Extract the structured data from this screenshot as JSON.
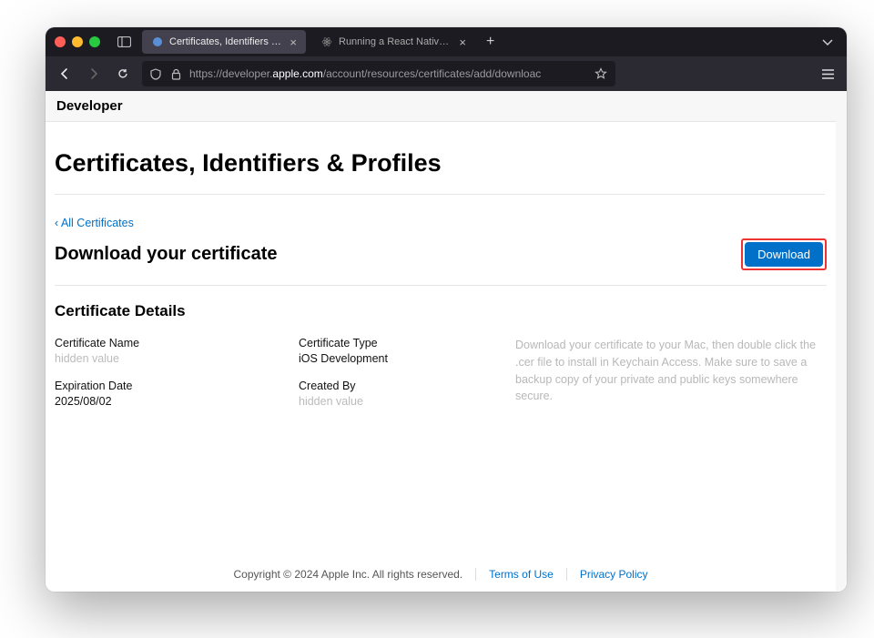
{
  "browser": {
    "tabs": [
      {
        "title": "Certificates, Identifiers & Profile",
        "active": true
      },
      {
        "title": "Running a React Native App on",
        "active": false
      }
    ],
    "url_prefix": "https://",
    "url_domain": "developer.apple.com",
    "url_path": "/account/resources/certificates/add/downloac"
  },
  "header": {
    "brand": "Developer"
  },
  "page": {
    "title": "Certificates, Identifiers & Profiles",
    "back_link": "‹ All Certificates",
    "sub_title": "Download your certificate",
    "download_button": "Download",
    "details_title": "Certificate Details",
    "fields": {
      "cert_name_label": "Certificate Name",
      "cert_name_value": "hidden value",
      "cert_type_label": "Certificate Type",
      "cert_type_value": "iOS Development",
      "exp_label": "Expiration Date",
      "exp_value": "2025/08/02",
      "created_by_label": "Created By",
      "created_by_value": "hidden value"
    },
    "help_text": "Download your certificate to your Mac, then double click the .cer file to install in Keychain Access. Make sure to save a backup copy of your private and public keys somewhere secure."
  },
  "footer": {
    "copyright": "Copyright © 2024 Apple Inc. All rights reserved.",
    "terms": "Terms of Use",
    "privacy": "Privacy Policy"
  }
}
